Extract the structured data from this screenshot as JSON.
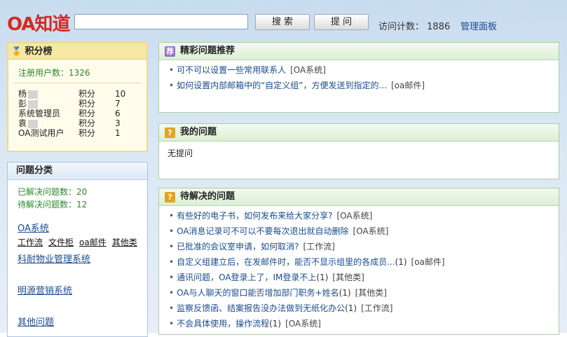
{
  "header": {
    "logo": "OA知道",
    "search_placeholder": "",
    "search_button": "搜 索",
    "ask_button": "提 问",
    "visit_label": "访问计数：",
    "visit_count": "1886",
    "admin_link": "管理面板"
  },
  "score_board": {
    "title": "积分榜",
    "registered": "注册用户数：1326",
    "rows": [
      {
        "name": "杨",
        "label": "积分",
        "score": "10"
      },
      {
        "name": "彭",
        "label": "积分",
        "score": "7"
      },
      {
        "name": "系统管理员",
        "label": "积分",
        "score": "6"
      },
      {
        "name": "袁",
        "label": "积分",
        "score": "3"
      },
      {
        "name": "OA测试用户",
        "label": "积分",
        "score": "1"
      }
    ]
  },
  "categories": {
    "title": "问题分类",
    "solved": "已解决问题数：20",
    "pending": "待解决问题数：12",
    "group1": "OA系统",
    "sub": [
      "工作流",
      "文件柜",
      "oa邮件",
      "其他类"
    ],
    "group2": "科耐物业管理系统",
    "group3": "明源营销系统",
    "group4": "其他问题"
  },
  "featured": {
    "title": "精彩问题推荐",
    "icon": "荐",
    "items": [
      {
        "text": "可不可以设置一些常用联系人",
        "count": "",
        "tag": "[OA系统]"
      },
      {
        "text": "如何设置内部邮箱中的“自定义组”，方便发送到指定的...",
        "count": "",
        "tag": "[oa邮件]"
      }
    ]
  },
  "mine": {
    "title": "我的问题",
    "icon": "?",
    "empty": "无提问"
  },
  "pending": {
    "title": "待解决的问题",
    "icon": "?",
    "items": [
      {
        "text": "有些好的电子书，如何发布来给大家分享?",
        "count": "",
        "tag": "[OA系统]"
      },
      {
        "text": "OA消息记录可不可以不要每次退出就自动删除",
        "count": "",
        "tag": "[OA系统]"
      },
      {
        "text": "已批准的会议室申请，如何取消?",
        "count": "",
        "tag": "[工作流]"
      },
      {
        "text": "自定义组建立后，在发邮件时，能否不显示组里的各成员...",
        "count": "(1)",
        "tag": "[oa邮件]"
      },
      {
        "text": "通讯问题，OA登录上了，IM登录不上",
        "count": "(1)",
        "tag": "[其他类]"
      },
      {
        "text": "OA与人聊天的窗口能否增加部门职务+姓名",
        "count": "(1)",
        "tag": "[其他类]"
      },
      {
        "text": "监察反馈函、结案报告没办法做到无纸化办公",
        "count": "(1)",
        "tag": "[工作流]"
      },
      {
        "text": "不会具体使用，操作流程",
        "count": "(1)",
        "tag": "[OA系统]"
      }
    ]
  },
  "colors": {
    "logo": "#d42a1f",
    "link": "#1a4b8e",
    "green": "#2d8a2d"
  }
}
